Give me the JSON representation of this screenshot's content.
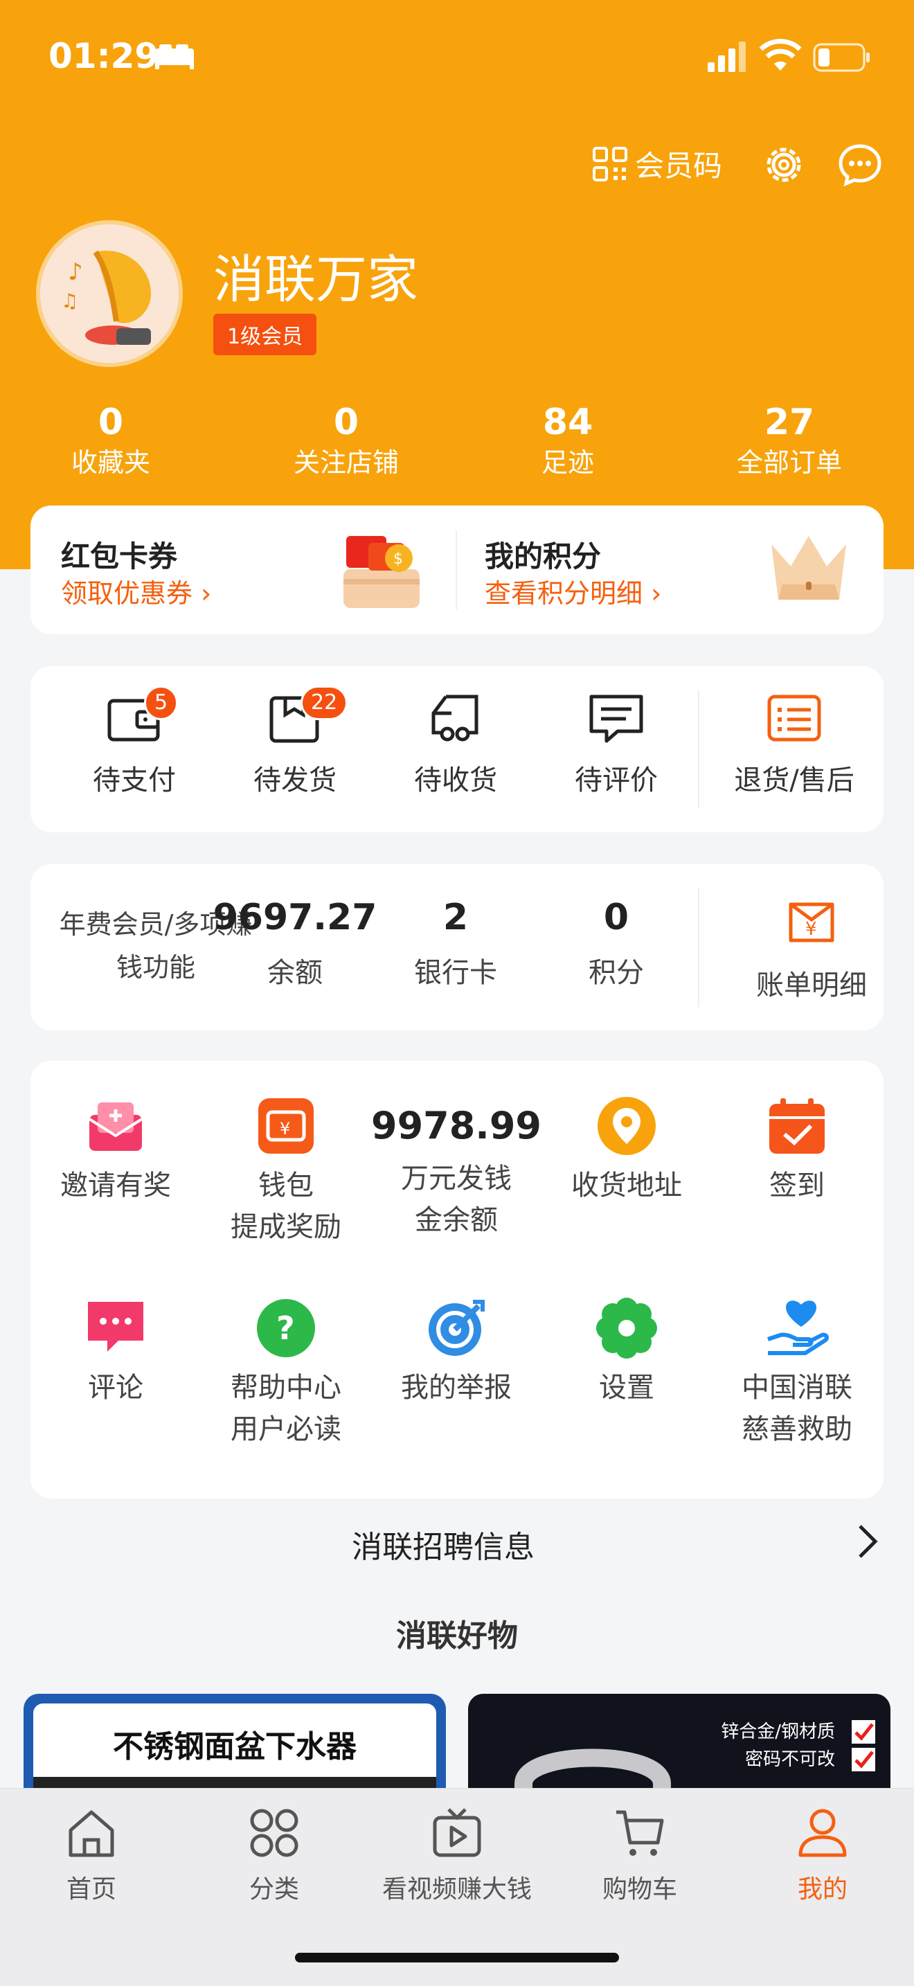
{
  "status_bar": {
    "time": "01:29"
  },
  "header": {
    "member_code_label": "会员码",
    "username": "消联万家",
    "level": "1级会员",
    "stats": [
      {
        "num": "0",
        "label": "收藏夹"
      },
      {
        "num": "0",
        "label": "关注店铺"
      },
      {
        "num": "84",
        "label": "足迹"
      },
      {
        "num": "27",
        "label": "全部订单"
      }
    ]
  },
  "coupons": {
    "left": {
      "title": "红包卡券",
      "sub": "领取优惠券"
    },
    "right": {
      "title": "我的积分",
      "sub": "查看积分明细"
    }
  },
  "orders": [
    {
      "label": "待支付",
      "badge": "5",
      "icon": "wallet-icon"
    },
    {
      "label": "待发货",
      "badge": "22",
      "icon": "box-icon"
    },
    {
      "label": "待收货",
      "badge": "",
      "icon": "truck-icon"
    },
    {
      "label": "待评价",
      "badge": "",
      "icon": "comment-icon"
    },
    {
      "label": "退货/售后",
      "badge": "",
      "icon": "list-icon"
    }
  ],
  "wallet": {
    "note": "年费会员/多项赚钱功能",
    "items": [
      {
        "num": "9697.27",
        "label": "余额"
      },
      {
        "num": "2",
        "label": "银行卡"
      },
      {
        "num": "0",
        "label": "积分"
      }
    ],
    "bill_label": "账单明细"
  },
  "tools": {
    "invite": "邀请有奖",
    "wallet_line1": "钱包",
    "wallet_line2": "提成奖励",
    "fund_amount": "9978.99",
    "fund_line1": "万元发钱",
    "fund_line2": "金余额",
    "address": "收货地址",
    "checkin": "签到",
    "comment": "评论",
    "help_line1": "帮助中心",
    "help_line2": "用户必读",
    "report": "我的举报",
    "settings": "设置",
    "charity_line1": "中国消联",
    "charity_line2": "慈善救助"
  },
  "recruit": "消联招聘信息",
  "goods_title": "消联好物",
  "products": {
    "p1_title": "不锈钢面盆下水器",
    "p2_feature1": "锌合金/钢材质",
    "p2_feature2": "密码不可改"
  },
  "tabbar": [
    {
      "label": "首页",
      "icon": "home-icon"
    },
    {
      "label": "分类",
      "icon": "category-icon"
    },
    {
      "label": "看视频赚大钱",
      "icon": "video-icon"
    },
    {
      "label": "购物车",
      "icon": "cart-icon"
    },
    {
      "label": "我的",
      "icon": "profile-icon"
    }
  ],
  "colors": {
    "header": "#f8a30c",
    "accent": "#f5600f",
    "badge": "#f5500f"
  }
}
